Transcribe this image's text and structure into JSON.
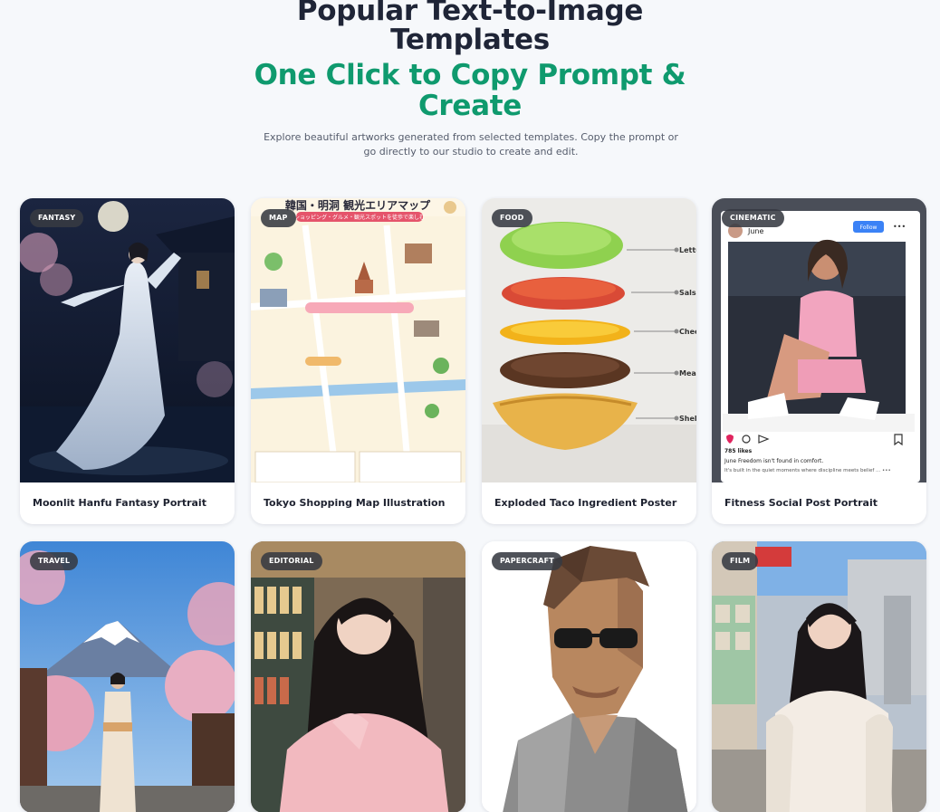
{
  "header": {
    "title": "Popular Text-to-Image Templates",
    "subtitle": "One Click to Copy Prompt & Create",
    "description": "Explore beautiful artworks generated from selected templates. Copy the prompt or go directly to our studio to create and edit."
  },
  "colors": {
    "accent": "#0f9a6e",
    "title": "#1f2537",
    "badge_bg": "#373a42"
  },
  "templates": [
    {
      "category": "FANTASY",
      "title": "Moonlit Hanfu Fantasy Portrait"
    },
    {
      "category": "MAP",
      "title": "Tokyo Shopping Map Illustration"
    },
    {
      "category": "FOOD",
      "title": "Exploded Taco Ingredient Poster"
    },
    {
      "category": "CINEMATIC",
      "title": "Fitness Social Post Portrait"
    },
    {
      "category": "TRAVEL",
      "title": ""
    },
    {
      "category": "EDITORIAL",
      "title": ""
    },
    {
      "category": "PAPERCRAFT",
      "title": ""
    },
    {
      "category": "FILM",
      "title": ""
    }
  ],
  "image_text": {
    "map_title": "韓国・明洞 観光エリアマップ",
    "map_sub": "ショッピング・グルメ・観光スポットを徒歩で楽しむ",
    "taco_labels": [
      "Lettu",
      "Salsa",
      "Chee",
      "Mea",
      "Shel"
    ],
    "social_user": "June",
    "social_follow": "Follow",
    "social_likes": "785 likes",
    "social_caption_1": "June Freedom isn't found in comfort.",
    "social_caption_2": "It's built in the quiet moments where discipline meets belief ... •••"
  }
}
